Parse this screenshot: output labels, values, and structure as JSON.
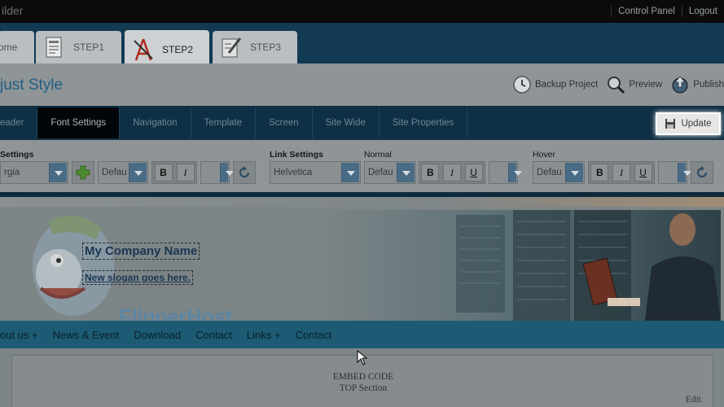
{
  "app": {
    "title": "ilder"
  },
  "top_links": [
    "Control Panel",
    "Logout"
  ],
  "steps": [
    {
      "label": "ome"
    },
    {
      "label": "STEP1"
    },
    {
      "label": "STEP2",
      "active": true
    },
    {
      "label": "STEP3"
    }
  ],
  "page_title": "just Style",
  "actions": {
    "backup": "Backup Project",
    "preview": "Preview",
    "publish": "Publish"
  },
  "subnav": {
    "items": [
      "eader",
      "Font Settings",
      "Navigation",
      "Template",
      "Screen",
      "Site Wide",
      "Site Properties"
    ],
    "active": "Font Settings",
    "update": "Update"
  },
  "font_settings": {
    "label": "Settings",
    "font_value": "rgia",
    "size_value": "Defau",
    "link_label": "Link Settings",
    "link_font": "Helvetica",
    "normal_label": "Normal",
    "normal_size": "Defau",
    "hover_label": "Hover",
    "hover_size": "Defau",
    "bold": "B",
    "italic": "I",
    "underline": "U"
  },
  "preview": {
    "company_name": "My Company Name",
    "slogan": "New slogan goes here.",
    "brand_text": "FlipperHost",
    "menu": [
      "out us +",
      "News & Event",
      "Download",
      "Contact",
      "Links +",
      "Contact"
    ],
    "embed_line1": "EMBED CODE",
    "embed_line2": "TOP Section",
    "edit": "Edit"
  },
  "colors": {
    "accent": "#1f5f85",
    "nav_bg": "#0f2f44",
    "menu_bg": "#1c5b73"
  }
}
